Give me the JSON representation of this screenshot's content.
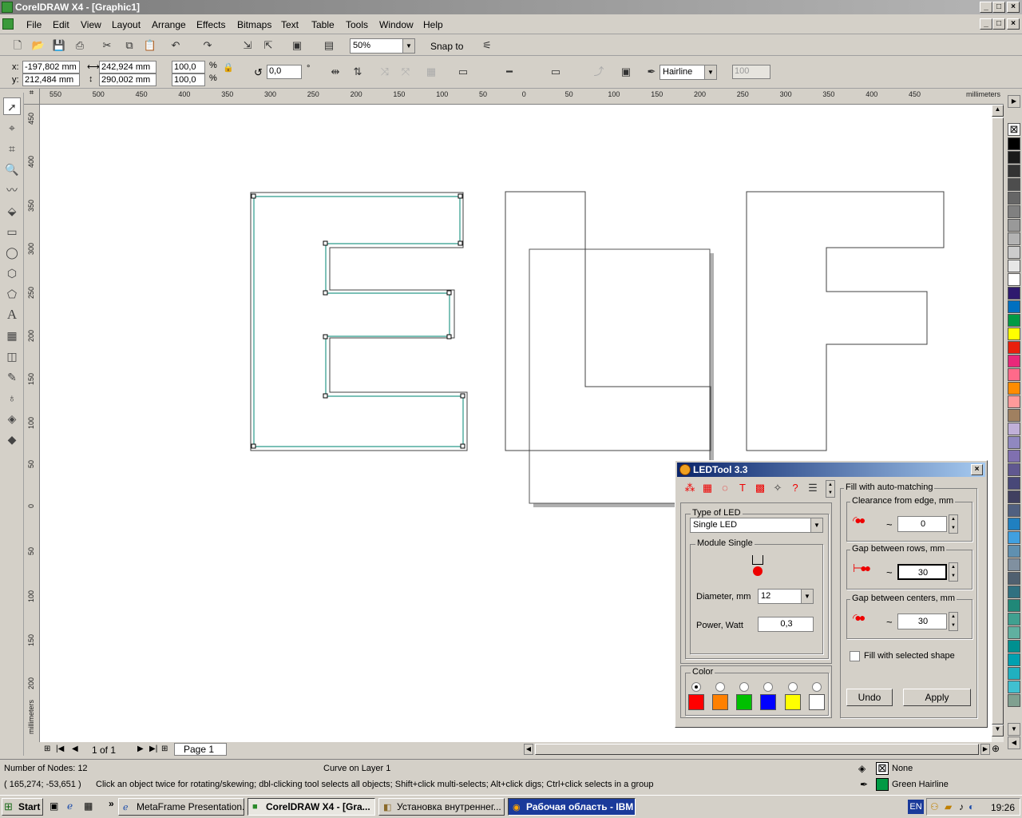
{
  "window": {
    "title": "CorelDRAW X4 - [Graphic1]"
  },
  "menu": [
    "File",
    "Edit",
    "View",
    "Layout",
    "Arrange",
    "Effects",
    "Bitmaps",
    "Text",
    "Table",
    "Tools",
    "Window",
    "Help"
  ],
  "standard_toolbar": {
    "zoom": "50%",
    "snap_to": "Snap to"
  },
  "property_bar": {
    "x_label": "x:",
    "x": "-197,802 mm",
    "y_label": "y:",
    "y": "212,484 mm",
    "width": "242,924 mm",
    "height": "290,002 mm",
    "scale_x": "100,0",
    "scale_y": "100,0",
    "percent": "%",
    "rotation": "0,0",
    "degree": "°",
    "outline_width": "Hairline",
    "smoothness": "100"
  },
  "ruler": {
    "unit": "millimeters",
    "h_ticks": [
      "550",
      "500",
      "450",
      "400",
      "350",
      "300",
      "250",
      "200",
      "150",
      "100",
      "50",
      "0",
      "50",
      "100",
      "150",
      "200",
      "250",
      "300",
      "350",
      "400",
      "450"
    ],
    "v_ticks": [
      "450",
      "400",
      "350",
      "300",
      "250",
      "200",
      "150",
      "100",
      "50",
      "0",
      "50",
      "100",
      "150",
      "200"
    ]
  },
  "page_nav": {
    "counter": "1 of 1",
    "tab": "Page 1"
  },
  "status": {
    "nodes": "Number of Nodes: 12",
    "layer": "Curve on Layer 1",
    "coords": "( 165,274; -53,651 )",
    "hint": "Click an object twice for rotating/skewing; dbl-clicking tool selects all objects; Shift+click multi-selects; Alt+click digs; Ctrl+click selects in a group",
    "fill": "None",
    "outline": "Green  Hairline"
  },
  "ledtool": {
    "title": "LEDTool 3.3",
    "type_group": "Type of LED",
    "type_value": "Single LED",
    "module_group": "Module Single",
    "diameter_label": "Diameter, mm",
    "diameter": "12",
    "power_label": "Power, Watt",
    "power": "0,3",
    "color_group": "Color",
    "colors": [
      "#ff0000",
      "#ff8000",
      "#00c000",
      "#0000ff",
      "#ffff00",
      "#ffffff"
    ],
    "fill_group": "Fill with auto-matching",
    "clearance_label": "Clearance from edge, mm",
    "clearance": "0",
    "rows_label": "Gap between rows, mm",
    "rows": "30",
    "centers_label": "Gap between centers, mm",
    "centers": "30",
    "tilde": "~",
    "fill_selected": "Fill with selected shape",
    "undo": "Undo",
    "apply": "Apply"
  },
  "palette": [
    "#000000",
    "#1a1a1a",
    "#333333",
    "#4d4d4d",
    "#666666",
    "#808080",
    "#999999",
    "#b3b3b3",
    "#cccccc",
    "#e6e6e6",
    "#ffffff",
    "#2e1a6e",
    "#0070c0",
    "#009a44",
    "#ffff00",
    "#e8200c",
    "#e8287a",
    "#ff6a8a",
    "#ff8c00",
    "#ff9a9a",
    "#a08060",
    "#c0b0d8",
    "#9088c0",
    "#8070b0",
    "#605890",
    "#484878",
    "#404060",
    "#506080",
    "#2080c0",
    "#40a0e0",
    "#6090b0",
    "#8090a0",
    "#506070",
    "#307080",
    "#208878",
    "#40a090",
    "#60b0a0",
    "#009090",
    "#00a0b0",
    "#20b0c0",
    "#40c0d0",
    "#80a090"
  ],
  "taskbar": {
    "start": "Start",
    "tasks": [
      "MetaFrame Presentation...",
      "CorelDRAW X4 - [Gra...",
      "Установка внутреннег...",
      "Рабочая область - IBM ..."
    ],
    "lang": "EN",
    "clock": "19:26"
  }
}
